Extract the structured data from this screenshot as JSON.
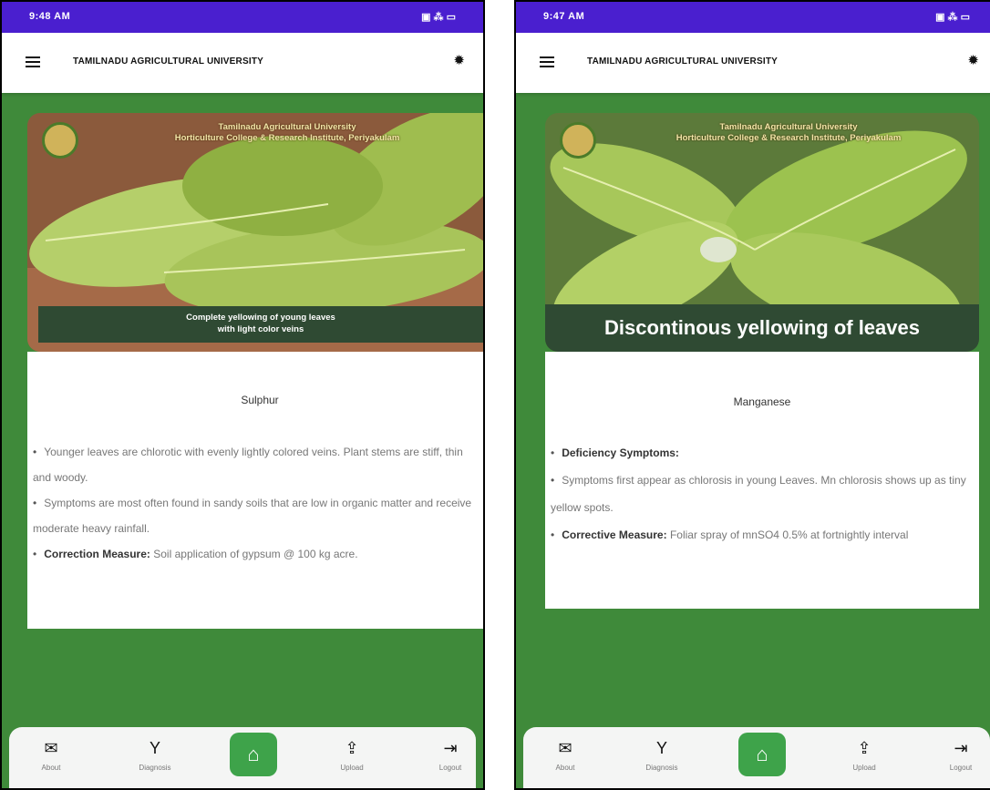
{
  "app_title": "TAMILNADU AGRICULTURAL UNIVERSITY",
  "banner": {
    "line1": "Tamilnadu Agricultural University",
    "line2": "Horticulture College & Research Institute, Periyakulam"
  },
  "nav": {
    "about": "About",
    "diagnosis": "Diagnosis",
    "upload": "Upload",
    "logout": "Logout"
  },
  "left": {
    "status_time": "9:48 AM",
    "image_caption_line1": "Complete yellowing of young leaves",
    "image_caption_line2": "with light color veins",
    "nutrient": "Sulphur",
    "b1": "Younger leaves are chlorotic with evenly lightly colored veins. Plant stems are stiff, thin and woody.",
    "b2": "Symptoms are most often found in sandy soils that are low in organic matter and receive moderate heavy rainfall.",
    "b3_label": "Correction Measure:",
    "b3_text": "Soil application of gypsum @ 100 kg acre."
  },
  "right": {
    "status_time": "9:47 AM",
    "image_caption": "Discontinous yellowing of leaves",
    "nutrient": "Manganese",
    "b1_label": "Deficiency Symptoms:",
    "b2": "Symptoms first appear as chlorosis in young Leaves. Mn chlorosis shows up as tiny yellow spots.",
    "b3_label": "Corrective Measure:",
    "b3_text": "Foliar spray of mnSO4 0.5% at fortnightly interval"
  },
  "colors": {
    "status_bar": "#4a1fcf",
    "background_green": "#3f8a3a",
    "home_button": "#3ea34a",
    "caption_bg": "#2f4a33"
  },
  "icons": {
    "menu": "hamburger-icon",
    "settings": "gear-icon",
    "about": "mail-icon",
    "diagnosis": "sprout-icon",
    "home": "home-icon",
    "upload": "upload-icon",
    "logout": "logout-icon"
  }
}
